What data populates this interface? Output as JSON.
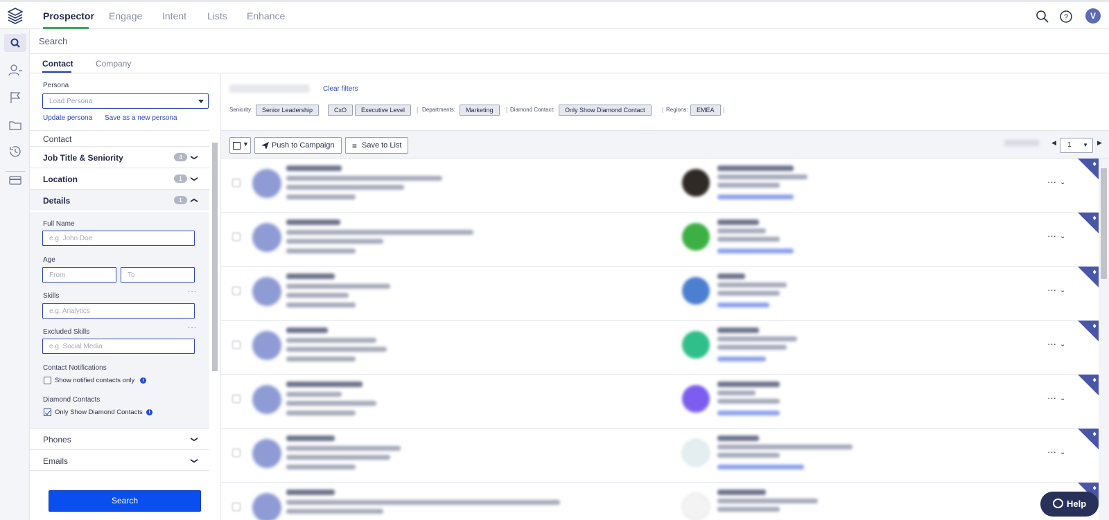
{
  "topnav": {
    "tabs": [
      "Prospector",
      "Engage",
      "Intent",
      "Lists",
      "Enhance"
    ],
    "active_tab": "Prospector",
    "avatar_initial": "V"
  },
  "search": {
    "label": "Search"
  },
  "subtabs": [
    "Contact",
    "Company"
  ],
  "persona": {
    "label": "Persona",
    "placeholder": "Load Persona",
    "update_link": "Update persona",
    "save_link": "Save as a new persona"
  },
  "filters": {
    "contact_heading": "Contact",
    "sections": [
      {
        "label": "Job Title & Seniority",
        "badge": "4"
      },
      {
        "label": "Location",
        "badge": "1"
      },
      {
        "label": "Details",
        "badge": "1"
      }
    ],
    "details": {
      "full_name_label": "Full Name",
      "full_name_placeholder": "e.g. John Doe",
      "age_label": "Age",
      "age_from_placeholder": "From",
      "age_to_placeholder": "To",
      "skills_label": "Skills",
      "skills_placeholder": "e.g. Analytics",
      "excluded_skills_label": "Excluded Skills",
      "excluded_skills_placeholder": "e.g. Social Media",
      "notifications_label": "Contact Notifications",
      "notifications_option": "Show notified contacts only",
      "diamond_label": "Diamond Contacts",
      "diamond_option": "Only Show Diamond Contacts"
    },
    "collapsed": [
      "Phones",
      "Emails"
    ],
    "search_button": "Search"
  },
  "active_filters": {
    "clear_label": "Clear filters",
    "groups": [
      {
        "label": "Seniority:",
        "chips": [
          "Senior Leadership",
          "CxO",
          "Executive Level"
        ]
      },
      {
        "label": "Departments:",
        "chips": [
          "Marketing"
        ]
      },
      {
        "label": "Diamond Contact:",
        "chips": [
          "Only Show Diamond Contact"
        ]
      },
      {
        "label": "Regions:",
        "chips": [
          "EMEA"
        ]
      }
    ]
  },
  "toolbar": {
    "push_label": "Push to Campaign",
    "save_label": "Save to List",
    "page": "1"
  },
  "colors": {
    "accent": "#0b4ef0",
    "nav_active_underline": "#3aa85a",
    "diamond_badge": "#4956a8",
    "help_button": "#273159"
  },
  "help_label": "Help"
}
